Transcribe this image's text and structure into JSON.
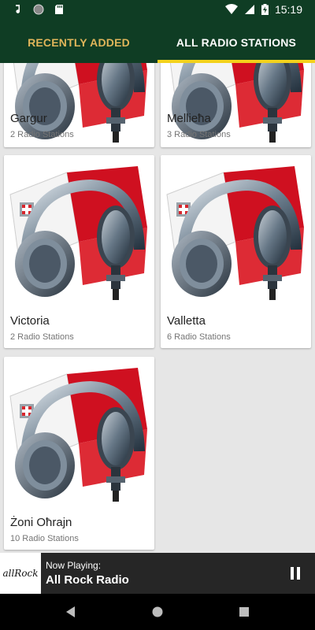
{
  "status_bar": {
    "time": "15:19",
    "icons": [
      "music-note-icon",
      "circle-icon",
      "sd-card-icon",
      "wifi-icon",
      "signal-icon",
      "battery-charging-icon"
    ]
  },
  "tabs": [
    {
      "label": "RECENTLY ADDED",
      "active": false
    },
    {
      "label": "ALL RADIO STATIONS",
      "active": true
    }
  ],
  "colors": {
    "app_bar": "#0f3d24",
    "tab_indicator": "#f3d21c",
    "inactive_tab_text": "#e0b55a",
    "player_bg": "#262626"
  },
  "stations": [
    {
      "name": "Gargur",
      "count": "2 Radio Stations"
    },
    {
      "name": "Mellieħa",
      "count": "3 Radio Stations"
    },
    {
      "name": "Victoria",
      "count": "2 Radio Stations"
    },
    {
      "name": "Valletta",
      "count": "6 Radio Stations"
    },
    {
      "name": "Żoni Oħrajn",
      "count": "10 Radio Stations"
    }
  ],
  "player": {
    "now_playing_label": "Now Playing:",
    "title": "All Rock Radio",
    "logo_text": "allRock",
    "state": "playing"
  },
  "nav": [
    "back-icon",
    "home-icon",
    "recents-icon"
  ]
}
